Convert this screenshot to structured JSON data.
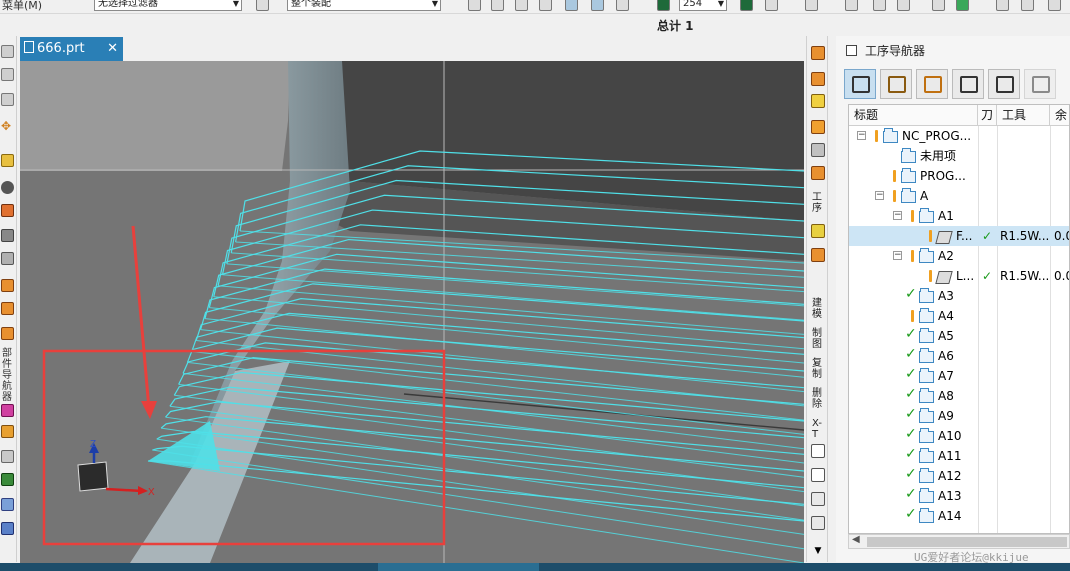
{
  "toolbar": {
    "menu_label": "菜单(M)",
    "filter_combo": "无选择过滤器",
    "assembly_combo": "整个装配",
    "number_combo": "254"
  },
  "info": {
    "total_label": "总计 1"
  },
  "document_tab": {
    "filename": "666.prt"
  },
  "left_toolbar": {
    "vertical_label": "部件导航器"
  },
  "right_toolbar": {
    "labels": [
      "工序",
      "建模",
      "制图",
      "复制",
      "删除",
      "X-T"
    ]
  },
  "navigator": {
    "title": "工序导航器",
    "columns": [
      "标题",
      "刀",
      "工具",
      "余"
    ],
    "rows": [
      {
        "label": "NC_PROG...",
        "status": "warn",
        "tool": "",
        "stock": "",
        "type": "program",
        "indent": 0,
        "toggle": "−"
      },
      {
        "label": "未用项",
        "status": "",
        "tool": "",
        "stock": "",
        "type": "program",
        "indent": 1,
        "toggle": ""
      },
      {
        "label": "PROG...",
        "status": "warn",
        "tool": "",
        "stock": "",
        "type": "program",
        "indent": 1,
        "toggle": ""
      },
      {
        "label": "A",
        "status": "warn",
        "tool": "",
        "stock": "",
        "type": "program",
        "indent": 1,
        "toggle": "−"
      },
      {
        "label": "A1",
        "status": "warn",
        "tool": "",
        "stock": "",
        "type": "program",
        "indent": 2,
        "toggle": "−"
      },
      {
        "label": "F...",
        "status": "warn",
        "tool": "R1.5W...",
        "stock": "0.0",
        "type": "operation",
        "indent": 3,
        "toggle": "",
        "highlighted": true
      },
      {
        "label": "A2",
        "status": "warn",
        "tool": "",
        "stock": "",
        "type": "program",
        "indent": 2,
        "toggle": "−"
      },
      {
        "label": "L...",
        "status": "warn",
        "tool": "R1.5W...",
        "stock": "0.0",
        "type": "operation",
        "indent": 3,
        "toggle": ""
      },
      {
        "label": "A3",
        "status": "ok",
        "tool": "",
        "stock": "",
        "type": "program",
        "indent": 2,
        "toggle": ""
      },
      {
        "label": "A4",
        "status": "warn",
        "tool": "",
        "stock": "",
        "type": "program",
        "indent": 2,
        "toggle": ""
      },
      {
        "label": "A5",
        "status": "ok",
        "tool": "",
        "stock": "",
        "type": "program",
        "indent": 2,
        "toggle": ""
      },
      {
        "label": "A6",
        "status": "ok",
        "tool": "",
        "stock": "",
        "type": "program",
        "indent": 2,
        "toggle": ""
      },
      {
        "label": "A7",
        "status": "ok",
        "tool": "",
        "stock": "",
        "type": "program",
        "indent": 2,
        "toggle": ""
      },
      {
        "label": "A8",
        "status": "ok",
        "tool": "",
        "stock": "",
        "type": "program",
        "indent": 2,
        "toggle": ""
      },
      {
        "label": "A9",
        "status": "ok",
        "tool": "",
        "stock": "",
        "type": "program",
        "indent": 2,
        "toggle": ""
      },
      {
        "label": "A10",
        "status": "ok",
        "tool": "",
        "stock": "",
        "type": "program",
        "indent": 2,
        "toggle": ""
      },
      {
        "label": "A11",
        "status": "ok",
        "tool": "",
        "stock": "",
        "type": "program",
        "indent": 2,
        "toggle": ""
      },
      {
        "label": "A12",
        "status": "ok",
        "tool": "",
        "stock": "",
        "type": "program",
        "indent": 2,
        "toggle": ""
      },
      {
        "label": "A13",
        "status": "ok",
        "tool": "",
        "stock": "",
        "type": "program",
        "indent": 2,
        "toggle": ""
      },
      {
        "label": "A14",
        "status": "ok",
        "tool": "",
        "stock": "",
        "type": "program",
        "indent": 2,
        "toggle": ""
      }
    ]
  },
  "viewport": {
    "axis_x": "X",
    "axis_z": "Z",
    "colors": {
      "toolpath": "#4fe0e8",
      "annotation": "#e8403c",
      "axis_x": "#d42020",
      "axis_z": "#1c3ea8"
    }
  },
  "watermark": "UG爱好者论坛@kkijue"
}
